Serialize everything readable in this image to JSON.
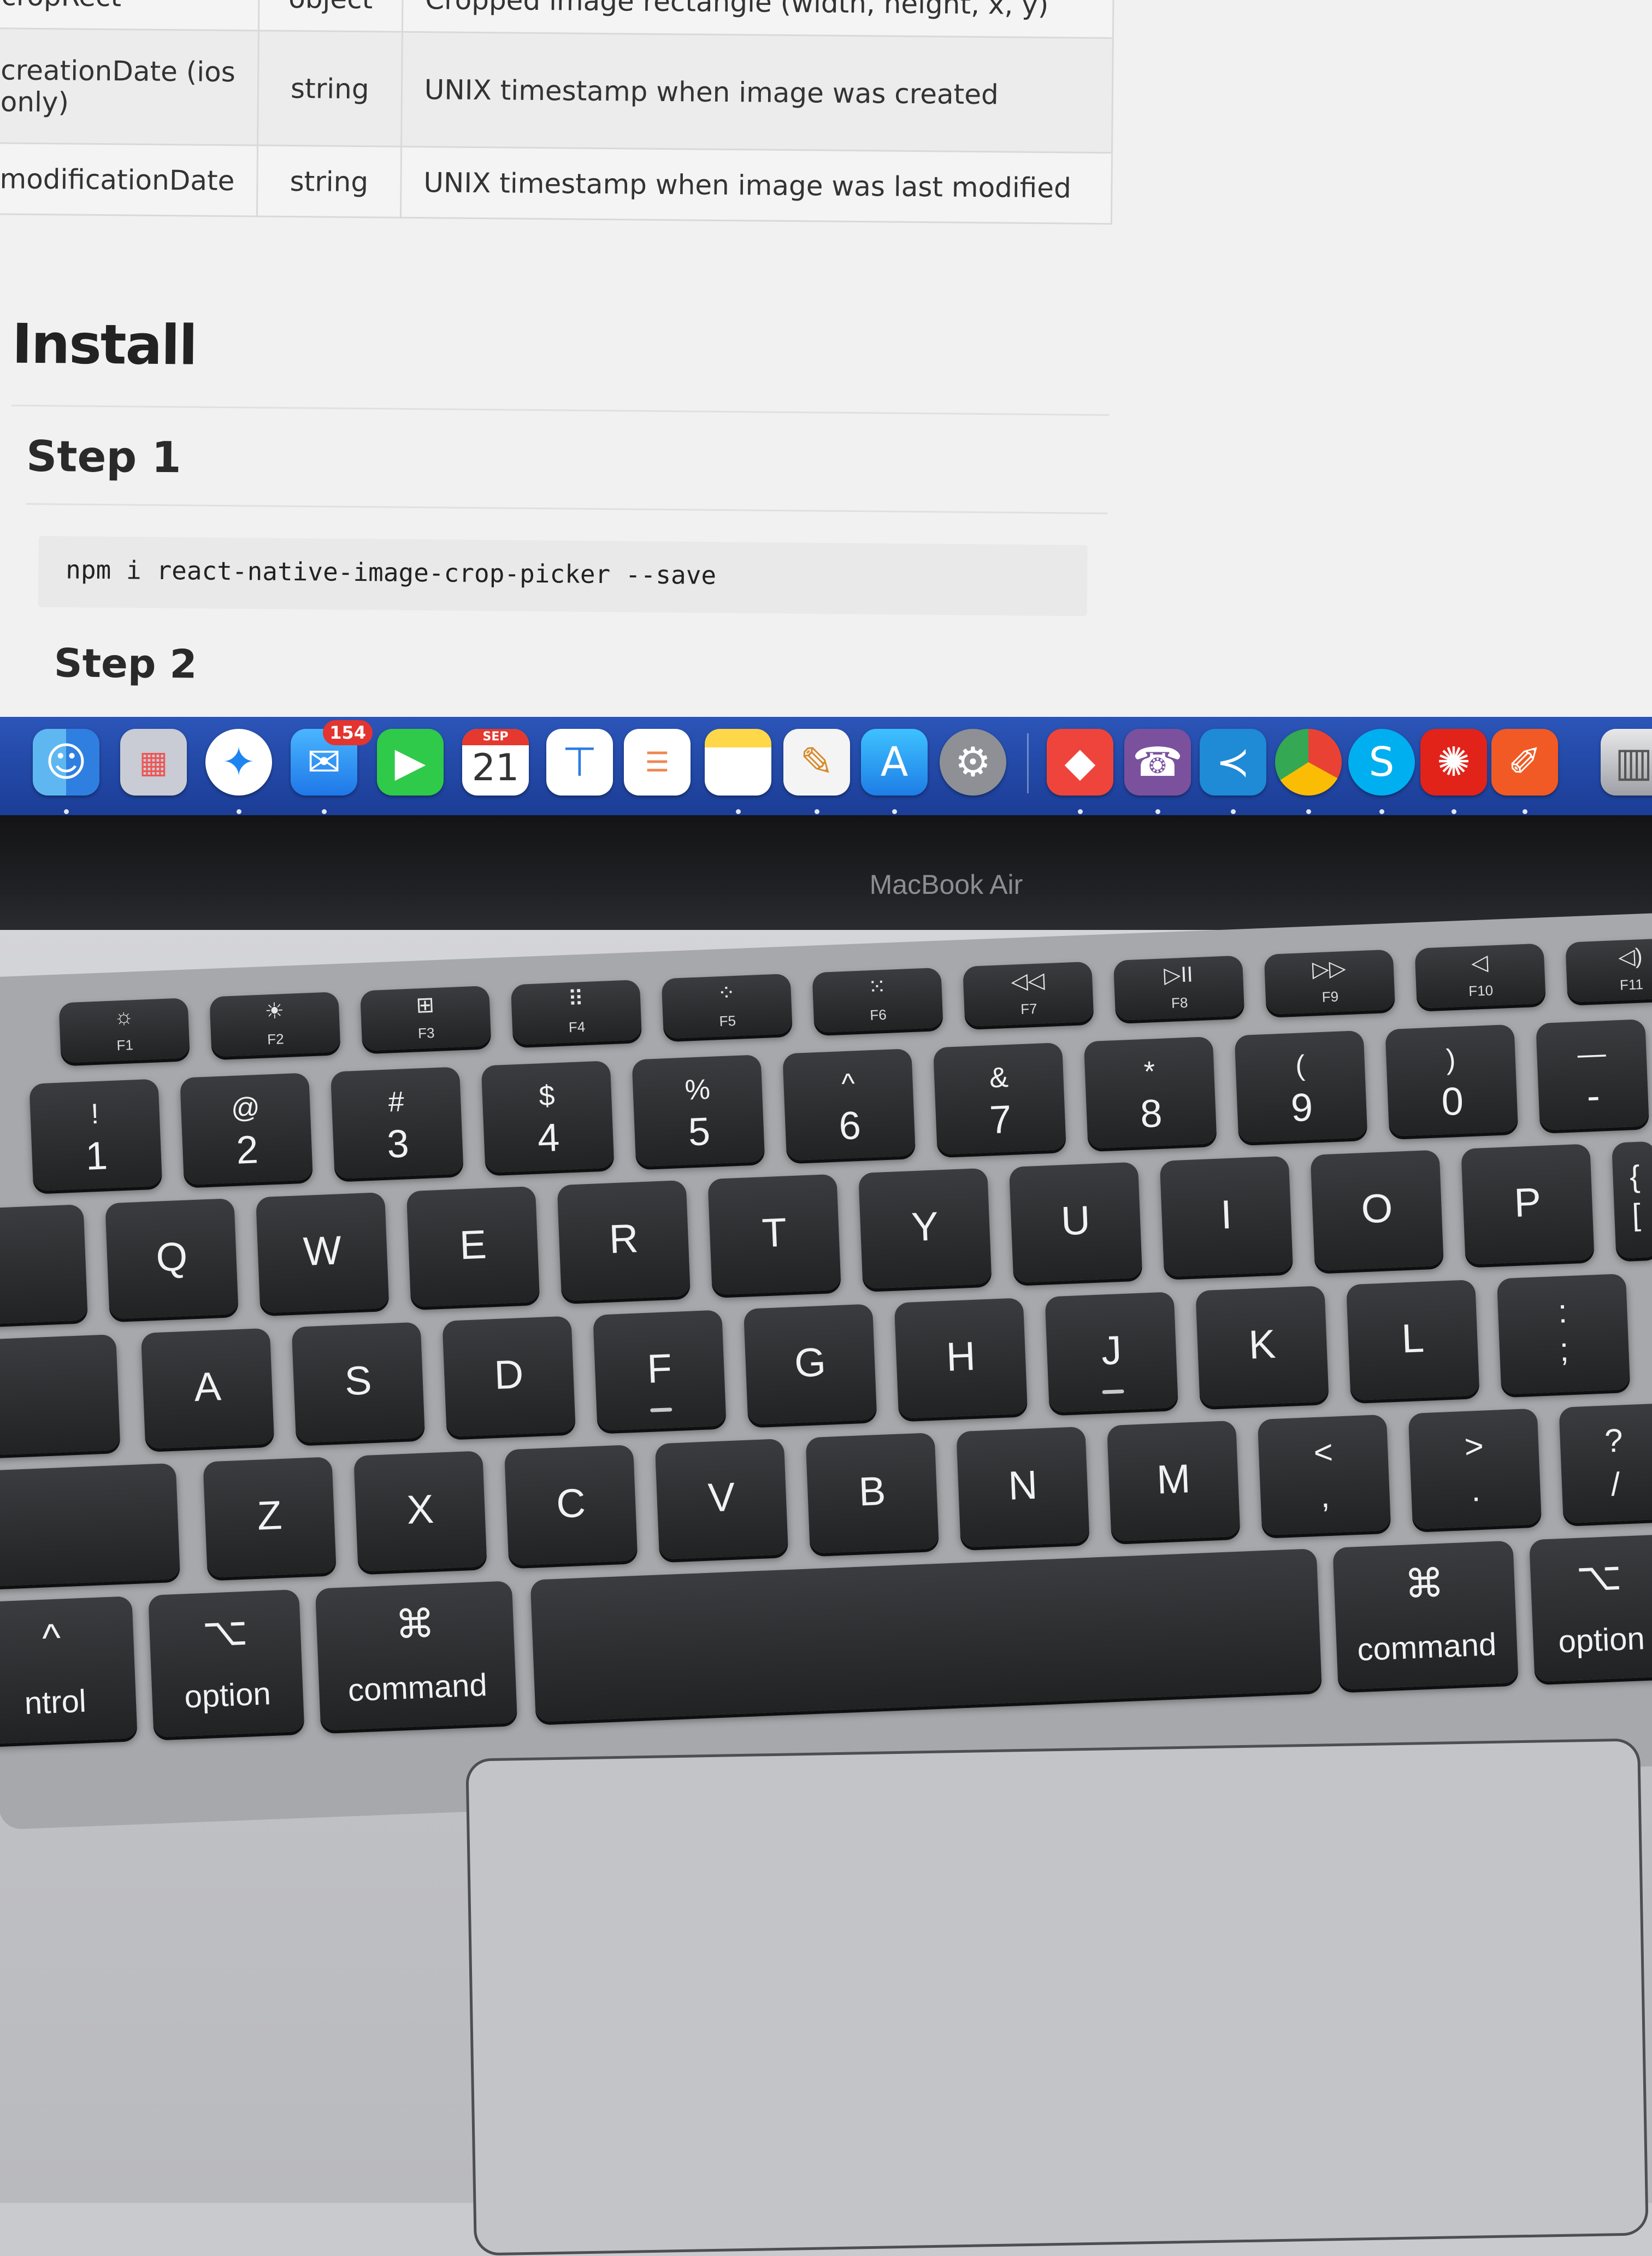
{
  "table": {
    "rows": [
      {
        "name": "cropRect",
        "type": "object",
        "description": "Cropped image rectangle (width, height, x, y)"
      },
      {
        "name": "creationDate (ios only)",
        "type": "string",
        "description": "UNIX timestamp when image was created"
      },
      {
        "name": "modificationDate",
        "type": "string",
        "description": "UNIX timestamp when image was last modified"
      }
    ]
  },
  "content": {
    "install_heading": "Install",
    "step1": "Step 1",
    "code": "npm i react-native-image-crop-picker ‑‑save",
    "step2": "Step 2"
  },
  "dock": {
    "mail_badge": "154",
    "calendar_month": "SEP",
    "calendar_day": "21",
    "icons": [
      "finder-icon",
      "launchpad-icon",
      "safari-icon",
      "mail-icon",
      "facetime-icon",
      "calendar-icon",
      "keynote-icon",
      "reminders-icon",
      "notes-icon",
      "script-editor-icon",
      "app-store-icon",
      "system-preferences-icon",
      "anydesk-icon",
      "viber-icon",
      "vscode-icon",
      "chrome-icon",
      "skype-icon",
      "acrobat-icon",
      "pencil-app-icon",
      "trash-icon"
    ]
  },
  "device": {
    "model_label": "MacBook Air"
  },
  "keyboard": {
    "fn_row": [
      {
        "glyph": "☼",
        "label": "F1"
      },
      {
        "glyph": "☀",
        "label": "F2"
      },
      {
        "glyph": "⊞",
        "label": "F3"
      },
      {
        "glyph": "⠿",
        "label": "F4"
      },
      {
        "glyph": "⁘",
        "label": "F5"
      },
      {
        "glyph": "⁙",
        "label": "F6"
      },
      {
        "glyph": "◁◁",
        "label": "F7"
      },
      {
        "glyph": "▷II",
        "label": "F8"
      },
      {
        "glyph": "▷▷",
        "label": "F9"
      },
      {
        "glyph": "◁",
        "label": "F10"
      },
      {
        "glyph": "◁)",
        "label": "F11"
      }
    ],
    "number_row": [
      {
        "shift": "!",
        "base": "1"
      },
      {
        "shift": "@",
        "base": "2"
      },
      {
        "shift": "#",
        "base": "3"
      },
      {
        "shift": "$",
        "base": "4"
      },
      {
        "shift": "%",
        "base": "5"
      },
      {
        "shift": "^",
        "base": "6"
      },
      {
        "shift": "&",
        "base": "7"
      },
      {
        "shift": "*",
        "base": "8"
      },
      {
        "shift": "(",
        "base": "9"
      },
      {
        "shift": ")",
        "base": "0"
      },
      {
        "shift": "—",
        "base": "-"
      },
      {
        "shift": "+",
        "base": "="
      }
    ],
    "qwerty_row": [
      "Q",
      "W",
      "E",
      "R",
      "T",
      "Y",
      "U",
      "I",
      "O",
      "P"
    ],
    "qwerty_extra": {
      "shift": "{",
      "base": "["
    },
    "home_row": [
      "A",
      "S",
      "D",
      "F",
      "G",
      "H",
      "J",
      "K",
      "L"
    ],
    "home_extra": {
      "shift": ":",
      "base": ";"
    },
    "bottom_row": [
      "Z",
      "X",
      "C",
      "V",
      "B",
      "N",
      "M"
    ],
    "bottom_extra": [
      {
        "shift": "<",
        "base": ","
      },
      {
        "shift": ">",
        "base": "."
      },
      {
        "shift": "?",
        "base": "/"
      }
    ],
    "modifiers": {
      "control_symbol": "^",
      "control_word": "ntrol",
      "option_symbol": "⌥",
      "option_word": "option",
      "command_symbol": "⌘",
      "command_word": "command"
    }
  }
}
